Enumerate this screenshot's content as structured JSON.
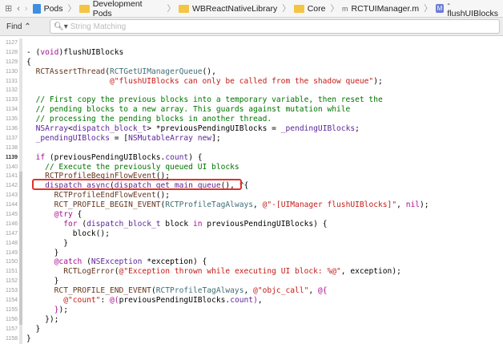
{
  "jumpbar": {
    "crumbs": [
      {
        "label": "Pods",
        "icon": "project-icon"
      },
      {
        "label": "Development Pods",
        "icon": "folder-icon"
      },
      {
        "label": "WBReactNativeLibrary",
        "icon": "folder-icon"
      },
      {
        "label": "Core",
        "icon": "folder-icon"
      },
      {
        "label": "RCTUIManager.m",
        "icon": "m-file-icon"
      },
      {
        "label": "-flushUIBlocks",
        "icon": "method-icon"
      }
    ]
  },
  "find": {
    "label": "Find ⌃",
    "placeholder": "String Matching"
  },
  "current_line": 1139,
  "highlight_color": "#e0302a",
  "lines": [
    {
      "n": "1127",
      "t": []
    },
    {
      "n": "1128",
      "t": [
        [
          "- (",
          ""
        ],
        [
          "void",
          "k"
        ],
        [
          ")flushUIBlocks",
          ""
        ]
      ]
    },
    {
      "n": "1129",
      "t": [
        [
          "{",
          ""
        ]
      ]
    },
    {
      "n": "1130",
      "t": [
        [
          "  ",
          ""
        ],
        [
          "RCTAssertThread",
          "m"
        ],
        [
          "(",
          ""
        ],
        [
          "RCTGetUIManagerQueue",
          "p"
        ],
        [
          "(),",
          ""
        ]
      ]
    },
    {
      "n": "1131",
      "t": [
        [
          "                  ",
          ""
        ],
        [
          "@\"flushUIBlocks can only be called from the shadow queue\"",
          "s"
        ],
        [
          ");",
          ""
        ]
      ]
    },
    {
      "n": "1132",
      "t": []
    },
    {
      "n": "1133",
      "t": [
        [
          "  ",
          ""
        ],
        [
          "// First copy the previous blocks into a temporary variable, then reset the",
          "c"
        ]
      ]
    },
    {
      "n": "1134",
      "t": [
        [
          "  ",
          ""
        ],
        [
          "// pending blocks to a new array. This guards against mutation while",
          "c"
        ]
      ]
    },
    {
      "n": "1135",
      "t": [
        [
          "  ",
          ""
        ],
        [
          "// processing the pending blocks in another thread.",
          "c"
        ]
      ]
    },
    {
      "n": "1136",
      "t": [
        [
          "  ",
          ""
        ],
        [
          "NSArray",
          "t"
        ],
        [
          "<",
          ""
        ],
        [
          "dispatch_block_t",
          "t"
        ],
        [
          "> *previousPendingUIBlocks = ",
          ""
        ],
        [
          "_pendingUIBlocks",
          "v"
        ],
        [
          ";",
          ""
        ]
      ]
    },
    {
      "n": "1137",
      "t": [
        [
          "  ",
          ""
        ],
        [
          "_pendingUIBlocks",
          "v"
        ],
        [
          " = [",
          ""
        ],
        [
          "NSMutableArray",
          "t"
        ],
        [
          " ",
          ""
        ],
        [
          "new",
          "t"
        ],
        [
          "];",
          ""
        ]
      ]
    },
    {
      "n": "1138",
      "t": []
    },
    {
      "n": "1139",
      "t": [
        [
          "  ",
          ""
        ],
        [
          "if",
          "k"
        ],
        [
          " (previousPendingUIBlocks.",
          ""
        ],
        [
          "count",
          "t"
        ],
        [
          ") {",
          ""
        ]
      ]
    },
    {
      "n": "1140",
      "t": [
        [
          "    ",
          ""
        ],
        [
          "// Execute the previously queued UI blocks",
          "c"
        ]
      ]
    },
    {
      "n": "1141",
      "t": [
        [
          "    ",
          ""
        ],
        [
          "RCTProfileBeginFlowEvent",
          "m"
        ],
        [
          "();",
          ""
        ]
      ]
    },
    {
      "n": "1142",
      "t": [
        [
          "    ",
          ""
        ],
        [
          "dispatch_async",
          "t"
        ],
        [
          "(",
          ""
        ],
        [
          "dispatch_get_main_queue",
          "t"
        ],
        [
          "(), ^{",
          ""
        ]
      ]
    },
    {
      "n": "1143",
      "t": [
        [
          "      ",
          ""
        ],
        [
          "RCTProfileEndFlowEvent",
          "m"
        ],
        [
          "();",
          ""
        ]
      ]
    },
    {
      "n": "1144",
      "t": [
        [
          "      ",
          ""
        ],
        [
          "RCT_PROFILE_BEGIN_EVENT",
          "m"
        ],
        [
          "(",
          ""
        ],
        [
          "RCTProfileTagAlways",
          "p"
        ],
        [
          ", ",
          ""
        ],
        [
          "@\"-[UIManager flushUIBlocks]\"",
          "s"
        ],
        [
          ", ",
          ""
        ],
        [
          "nil",
          "k"
        ],
        [
          ");",
          ""
        ]
      ]
    },
    {
      "n": "1145",
      "t": [
        [
          "      ",
          ""
        ],
        [
          "@try",
          "k"
        ],
        [
          " {",
          ""
        ]
      ]
    },
    {
      "n": "1146",
      "t": [
        [
          "        ",
          ""
        ],
        [
          "for",
          "k"
        ],
        [
          " (",
          ""
        ],
        [
          "dispatch_block_t",
          "t"
        ],
        [
          " block ",
          ""
        ],
        [
          "in",
          "k"
        ],
        [
          " previousPendingUIBlocks) {",
          ""
        ]
      ]
    },
    {
      "n": "1147",
      "t": [
        [
          "          block();",
          ""
        ]
      ]
    },
    {
      "n": "1148",
      "t": [
        [
          "        }",
          ""
        ]
      ]
    },
    {
      "n": "1149",
      "t": [
        [
          "      }",
          ""
        ]
      ]
    },
    {
      "n": "1150",
      "t": [
        [
          "      ",
          ""
        ],
        [
          "@catch",
          "k"
        ],
        [
          " (",
          ""
        ],
        [
          "NSException",
          "t"
        ],
        [
          " *exception) {",
          ""
        ]
      ]
    },
    {
      "n": "1151",
      "t": [
        [
          "        ",
          ""
        ],
        [
          "RCTLogError",
          "m"
        ],
        [
          "(",
          ""
        ],
        [
          "@\"Exception thrown while executing UI block: %@\"",
          "s"
        ],
        [
          ", exception);",
          ""
        ]
      ]
    },
    {
      "n": "1152",
      "t": [
        [
          "      }",
          ""
        ]
      ]
    },
    {
      "n": "1153",
      "t": [
        [
          "      ",
          ""
        ],
        [
          "RCT_PROFILE_END_EVENT",
          "m"
        ],
        [
          "(",
          ""
        ],
        [
          "RCTProfileTagAlways",
          "p"
        ],
        [
          ", ",
          ""
        ],
        [
          "@\"objc_call\"",
          "s"
        ],
        [
          ", ",
          ""
        ],
        [
          "@{",
          "k"
        ]
      ]
    },
    {
      "n": "1154",
      "t": [
        [
          "        ",
          ""
        ],
        [
          "@\"count\"",
          "s"
        ],
        [
          ": ",
          ""
        ],
        [
          "@(",
          "k"
        ],
        [
          "previousPendingUIBlocks.",
          ""
        ],
        [
          "count",
          "t"
        ],
        [
          ")",
          "k"
        ],
        [
          ",",
          ""
        ]
      ]
    },
    {
      "n": "1155",
      "t": [
        [
          "      ",
          ""
        ],
        [
          "}",
          "k"
        ],
        [
          ");",
          ""
        ]
      ]
    },
    {
      "n": "1156",
      "t": [
        [
          "    });",
          ""
        ]
      ]
    },
    {
      "n": "1157",
      "t": [
        [
          "  }",
          ""
        ]
      ]
    },
    {
      "n": "1158",
      "t": [
        [
          "}",
          ""
        ]
      ]
    }
  ]
}
